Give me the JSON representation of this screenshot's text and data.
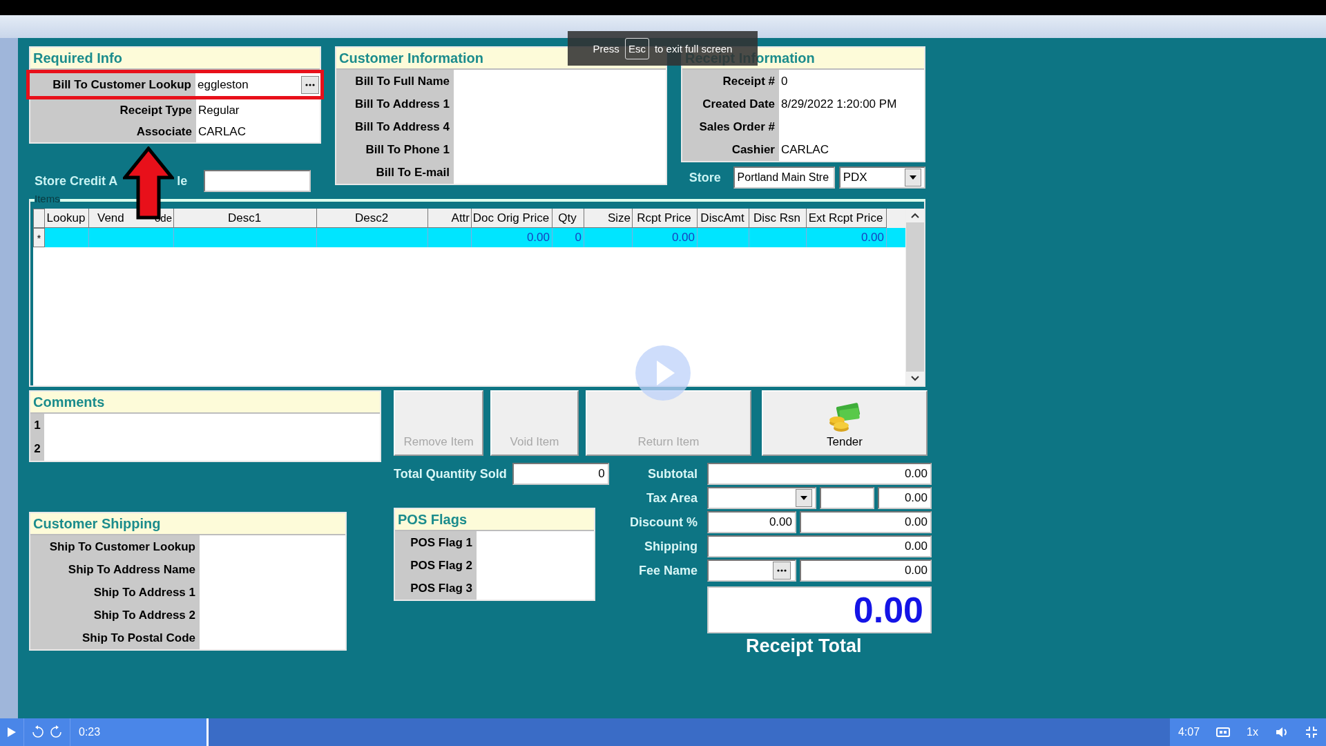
{
  "required_info": {
    "title": "Required Info",
    "rows": [
      {
        "label": "Bill To Customer Lookup",
        "value": "eggleston",
        "kind": "lookup",
        "highlighted": true
      },
      {
        "label": "Receipt Type",
        "value": "Regular",
        "kind": "text",
        "highlighted": false
      },
      {
        "label": "Associate",
        "value": "CARLAC",
        "kind": "text",
        "highlighted": false
      }
    ]
  },
  "store_credit": {
    "label_start": "Store Credit A",
    "label_end": "le"
  },
  "customer_information": {
    "title": "Customer Information",
    "rows": [
      "Bill To Full Name",
      "Bill To Address 1",
      "Bill To Address 4",
      "Bill To Phone 1",
      "Bill To E-mail"
    ]
  },
  "receipt_information": {
    "title": "Receipt Information",
    "rows": [
      {
        "label": "Receipt #",
        "value": "0"
      },
      {
        "label": "Created Date",
        "value": "8/29/2022 1:20:00 PM"
      },
      {
        "label": "Sales Order #"
      },
      {
        "label": "Cashier",
        "value": "CARLAC"
      }
    ]
  },
  "store": {
    "label": "Store",
    "name": "Portland Main Stre",
    "code": "PDX"
  },
  "items": {
    "title": "Items",
    "columns": [
      {
        "label": "Lookup"
      },
      {
        "label": "Vend",
        "tail": "ode"
      },
      {
        "label": "Desc1"
      },
      {
        "label": "Desc2"
      },
      {
        "label": "Attr"
      },
      {
        "label": "Doc Orig Price"
      },
      {
        "label": "Qty"
      },
      {
        "label": "Size"
      },
      {
        "label": "Rcpt Price"
      },
      {
        "label": "DiscAmt"
      },
      {
        "label": "Disc Rsn"
      },
      {
        "label": "Ext Rcpt Price"
      }
    ],
    "rows": [
      {
        "marker": "*",
        "selected": true,
        "cells": [
          "",
          "",
          "",
          "",
          "",
          "0.00",
          "0",
          "",
          "0.00",
          "",
          "",
          "0.00"
        ]
      }
    ]
  },
  "comments": {
    "title": "Comments",
    "lines": [
      "1",
      "2"
    ]
  },
  "buttons": [
    {
      "label": "Remove Item",
      "disabled": true,
      "kind": "plain"
    },
    {
      "label": "Void Item",
      "disabled": true,
      "kind": "plain"
    },
    {
      "label": "Return Item",
      "disabled": true,
      "kind": "plain"
    },
    {
      "label": "Tender",
      "disabled": false,
      "kind": "money"
    }
  ],
  "total_quantity": {
    "label": "Total Quantity Sold",
    "value": "0"
  },
  "totals": [
    {
      "label": "Subtotal",
      "kind": "single",
      "values": [
        "0.00"
      ]
    },
    {
      "label": "Tax Area",
      "kind": "dropdown",
      "values": [
        "0.00"
      ]
    },
    {
      "label": "Discount %",
      "kind": "split",
      "values": [
        "0.00",
        "0.00"
      ]
    },
    {
      "label": "Shipping",
      "kind": "single",
      "values": [
        "0.00"
      ]
    },
    {
      "label": "Fee Name",
      "kind": "lookup",
      "values": [
        "0.00"
      ]
    }
  ],
  "receipt_total": {
    "value": "0.00",
    "label": "Receipt Total"
  },
  "customer_shipping": {
    "title": "Customer Shipping",
    "rows": [
      "Ship To Customer Lookup",
      "Ship To Address Name",
      "Ship To Address 1",
      "Ship To Address 2",
      "Ship To Postal Code"
    ]
  },
  "pos_flags": {
    "title": "POS Flags",
    "rows": [
      "POS Flag 1",
      "POS Flag 2",
      "POS Flag 3"
    ]
  },
  "fullscreen_notice": {
    "before": "Press",
    "key": "Esc",
    "after": "to exit full screen"
  },
  "player": {
    "current": "0:23",
    "duration": "4:07",
    "speed": "1x",
    "level": 0.094
  }
}
